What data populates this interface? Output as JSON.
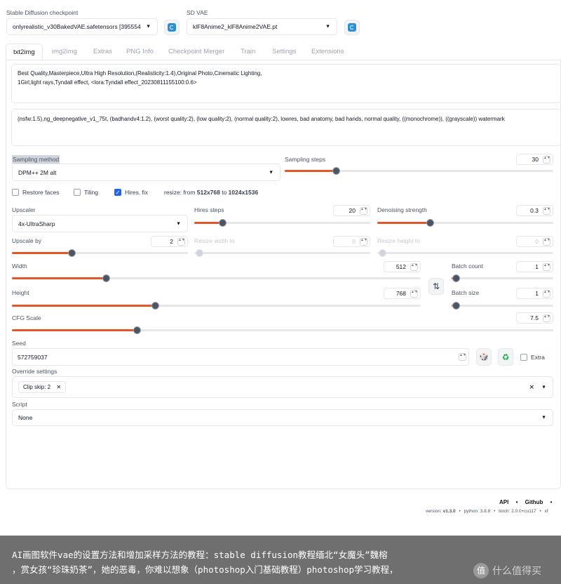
{
  "checkpoint": {
    "label": "Stable Diffusion checkpoint",
    "value": "onlyrealistic_v30BakedVAE.safetensors [395554"
  },
  "vae": {
    "label": "SD VAE",
    "value": "klF8Anime2_klF8Anime2VAE.pt"
  },
  "tabs": [
    {
      "label": "txt2img"
    },
    {
      "label": "img2img"
    },
    {
      "label": "Extras"
    },
    {
      "label": "PNG Info"
    },
    {
      "label": "Checkpoint Merger"
    },
    {
      "label": "Train"
    },
    {
      "label": "Settings"
    },
    {
      "label": "Extensions"
    }
  ],
  "prompt": {
    "positive": "Best Quality,Masterpiece,Ultra High Resolution,(Realisticity:1.4),Original Photo,Cinematic Lighting,\n1Girl,light rays,Tyndall effect, <lora:Tyndall effect_20230811155100:0.6>",
    "negative": "(nsfw:1.5),ng_deepnegative_v1_75t, (badhandv4:1.2), (worst quality:2), (low quality:2), (normal quality:2), lowres, bad anatomy, bad hands, normal quality, ((monochrome)), ((grayscale)) watermark"
  },
  "sampling": {
    "method_label": "Sampling method",
    "method_value": "DPM++ 2M alt",
    "steps_label": "Sampling steps",
    "steps_value": "30",
    "steps_fraction": 0.19
  },
  "options": {
    "restore_faces": "Restore faces",
    "tiling": "Tiling",
    "hires_fix": "Hires. fix",
    "resize_prefix": "resize: from ",
    "resize_from": "512x768",
    "resize_to_word": " to ",
    "resize_to": "1024x1536"
  },
  "hires": {
    "upscaler_label": "Upscaler",
    "upscaler_value": "4x-UltraSharp",
    "steps_label": "Hires steps",
    "steps_value": "20",
    "steps_fraction": 0.16,
    "denoise_label": "Denoising strength",
    "denoise_value": "0.3",
    "denoise_fraction": 0.3,
    "upscale_by_label": "Upscale by",
    "upscale_by_value": "2",
    "upscale_by_fraction": 0.34,
    "resize_w_label": "Resize width to",
    "resize_w_value": "0",
    "resize_h_label": "Resize height to",
    "resize_h_value": "0"
  },
  "size": {
    "width_label": "Width",
    "width_value": "512",
    "width_fraction": 0.23,
    "height_label": "Height",
    "height_value": "768",
    "height_fraction": 0.35,
    "batch_count_label": "Batch count",
    "batch_count_value": "1",
    "batch_count_fraction": 0.0,
    "batch_size_label": "Batch size",
    "batch_size_value": "1",
    "batch_size_fraction": 0.0,
    "swap_icon": "⇅"
  },
  "cfg": {
    "label": "CFG Scale",
    "value": "7.5",
    "fraction": 0.23
  },
  "seed": {
    "label": "Seed",
    "value": "572759037",
    "extra_label": "Extra",
    "dice_icon": "🎲",
    "recycle_icon": "♻"
  },
  "override": {
    "label": "Override settings",
    "chip": "Clip skip: 2"
  },
  "script": {
    "label": "Script",
    "value": "None"
  },
  "footer": {
    "api": "API",
    "sep": "•",
    "github": "Github",
    "version_prefix": "version: ",
    "version": "v1.3.0",
    "python_prefix": "python: ",
    "python": "3.8.8",
    "torch_prefix": "torch: ",
    "torch": "2.0.0+cu117",
    "tail": "xf"
  },
  "banner": {
    "line1": "AI画图软件vae的设置方法和增加采样方法的教程：stable diffusion教程缅北“女魔头”魏榕",
    "line2": "，赏女孩“珍珠奶茶”，她的恶毒，你难以想象（photoshop入门基础教程）photoshop学习教程，",
    "watermark": "什么值得买"
  },
  "colors": {
    "accent": "#e2572a",
    "refresh": "#2a8fd4",
    "checkbox": "#2563eb"
  }
}
